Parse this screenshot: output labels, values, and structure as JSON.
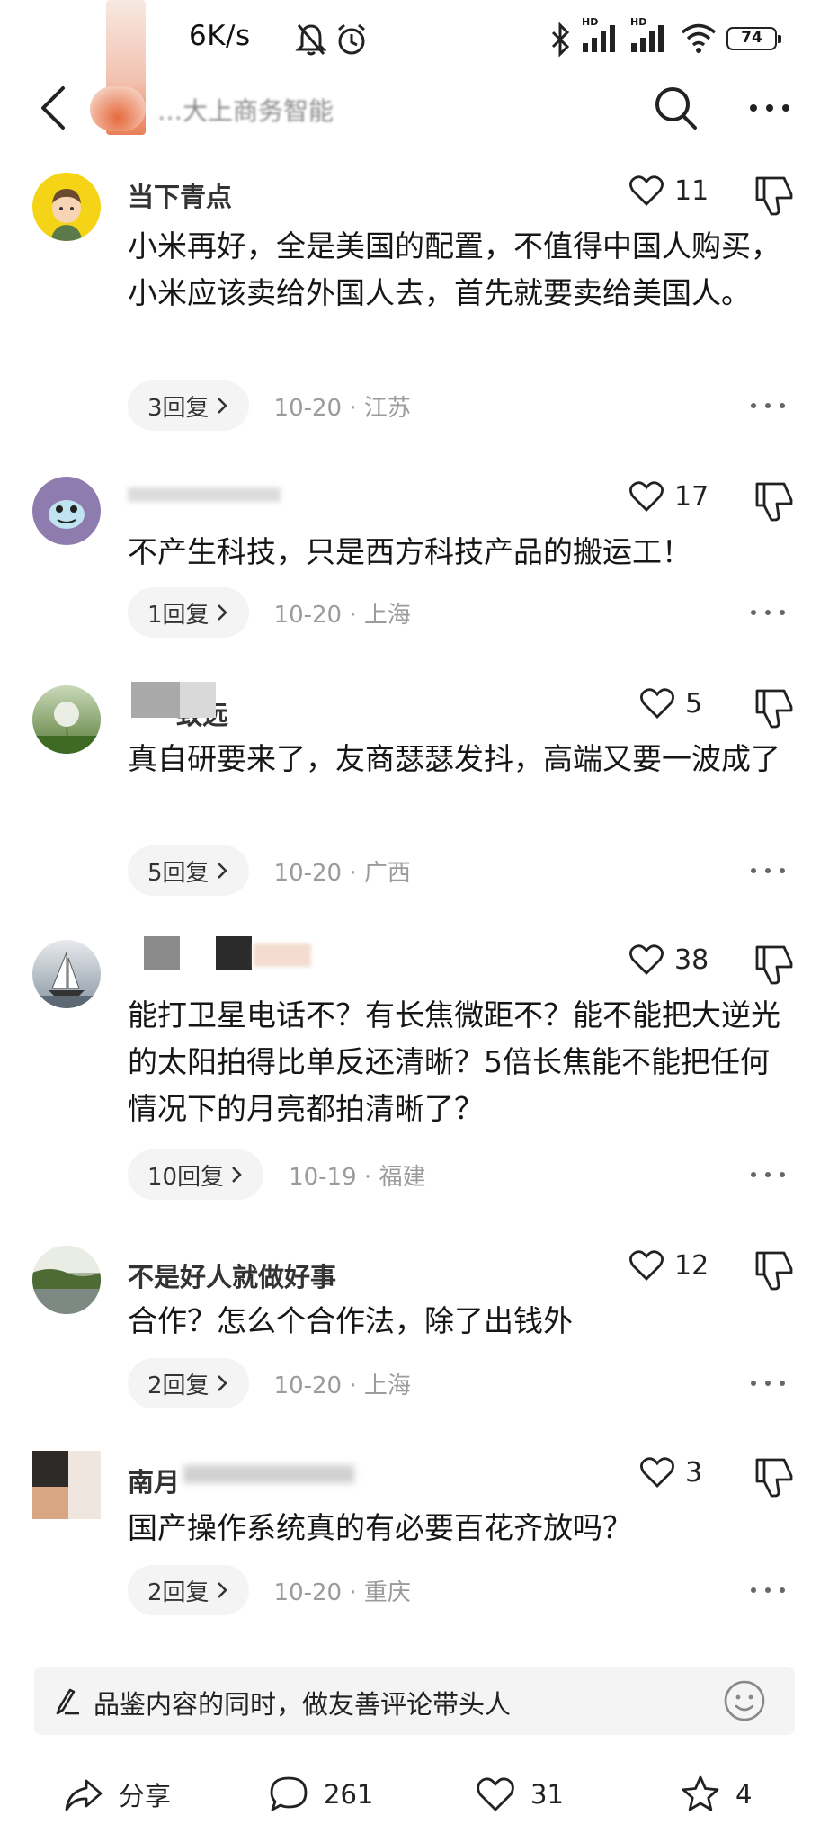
{
  "status_bar": {
    "speed": "6K/s",
    "battery": "74",
    "signal_badge_1": "HD",
    "signal_badge_2": "HD"
  },
  "header": {
    "title": "…大上商务智能"
  },
  "comments": [
    {
      "username": "当下青点",
      "likes": "11",
      "text": "小米再好，全是美国的配置，不值得中国人购买，小米应该卖给外国人去，首先就要卖给美国人。",
      "replies": "3回复",
      "date_location": "10-20 · 江苏"
    },
    {
      "username": "",
      "likes": "17",
      "text": "不产生科技，只是西方科技产品的搬运工！",
      "replies": "1回复",
      "date_location": "10-20 · 上海"
    },
    {
      "username": "致远",
      "likes": "5",
      "text": "真自研要来了，友商瑟瑟发抖，高端又要一波成了",
      "replies": "5回复",
      "date_location": "10-20 · 广西"
    },
    {
      "username": "",
      "likes": "38",
      "text": "能打卫星电话不？有长焦微距不？能不能把大逆光的太阳拍得比单反还清晰？5倍长焦能不能把任何情况下的月亮都拍清晰了？",
      "replies": "10回复",
      "date_location": "10-19 · 福建"
    },
    {
      "username": "不是好人就做好事",
      "likes": "12",
      "text": "合作？怎么个合作法，除了出钱外",
      "replies": "2回复",
      "date_location": "10-20 · 上海"
    },
    {
      "username": "南月",
      "likes": "3",
      "text": "国产操作系统真的有必要百花齐放吗？",
      "replies": "2回复",
      "date_location": "10-20 · 重庆"
    }
  ],
  "input_bar": {
    "placeholder": "品鉴内容的同时，做友善评论带头人"
  },
  "bottom_bar": {
    "share_label": "分享",
    "comment_count": "261",
    "like_count": "31",
    "favorite_count": "4"
  }
}
